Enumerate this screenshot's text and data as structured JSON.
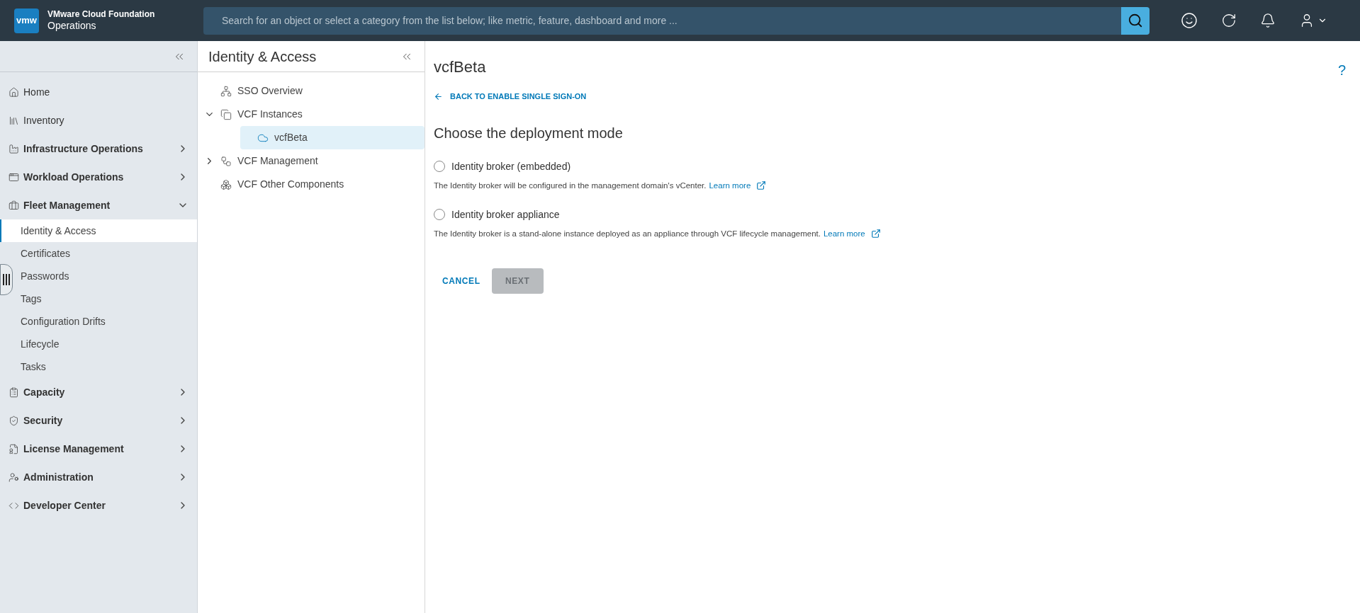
{
  "header": {
    "logo": "vmw",
    "product_line1": "VMware Cloud Foundation",
    "product_line2": "Operations",
    "search": {
      "placeholder": "Search for an object or select a category from the list below; like metric, feature, dashboard and more ..."
    }
  },
  "sidebar": {
    "items": [
      {
        "label": "Home",
        "kind": "link",
        "selected": false
      },
      {
        "label": "Inventory",
        "kind": "link",
        "selected": false
      },
      {
        "label": "Infrastructure Operations",
        "kind": "section",
        "expanded": false,
        "selected": false
      },
      {
        "label": "Workload Operations",
        "kind": "section",
        "expanded": false,
        "selected": false
      },
      {
        "label": "Fleet Management",
        "kind": "section",
        "expanded": true,
        "selected": false,
        "children": [
          {
            "label": "Identity & Access",
            "selected": true
          },
          {
            "label": "Certificates",
            "selected": false
          },
          {
            "label": "Passwords",
            "selected": false
          },
          {
            "label": "Tags",
            "selected": false
          },
          {
            "label": "Configuration Drifts",
            "selected": false
          },
          {
            "label": "Lifecycle",
            "selected": false
          },
          {
            "label": "Tasks",
            "selected": false
          }
        ]
      },
      {
        "label": "Capacity",
        "kind": "section",
        "expanded": false,
        "selected": false
      },
      {
        "label": "Security",
        "kind": "section",
        "expanded": false,
        "selected": false
      },
      {
        "label": "License Management",
        "kind": "section",
        "expanded": false,
        "selected": false
      },
      {
        "label": "Administration",
        "kind": "section",
        "expanded": false,
        "selected": false
      },
      {
        "label": "Developer Center",
        "kind": "section",
        "expanded": false,
        "selected": false
      }
    ]
  },
  "subnav": {
    "title": "Identity & Access",
    "tree": [
      {
        "label": "SSO Overview",
        "selected": false
      },
      {
        "label": "VCF Instances",
        "selected": false,
        "expanded": true,
        "children": [
          {
            "label": "vcfBeta",
            "selected": true
          }
        ]
      },
      {
        "label": "VCF Management",
        "selected": false,
        "expanded": false
      },
      {
        "label": "VCF Other Components",
        "selected": false
      }
    ]
  },
  "main": {
    "title": "vcfBeta",
    "back_link": "BACK TO ENABLE SINGLE SIGN-ON",
    "help": "?",
    "heading": "Choose the deployment mode",
    "options": [
      {
        "label": "Identity broker (embedded)",
        "selected": false,
        "description": "The Identity broker will be configured in the management domain's vCenter.",
        "link": "Learn more"
      },
      {
        "label": "Identity broker appliance",
        "selected": false,
        "description": "The Identity broker is a stand-alone instance deployed as an appliance through VCF lifecycle management.",
        "link": "Learn more"
      }
    ],
    "cancel": "CANCEL",
    "next": {
      "label": "NEXT",
      "disabled": true
    }
  }
}
